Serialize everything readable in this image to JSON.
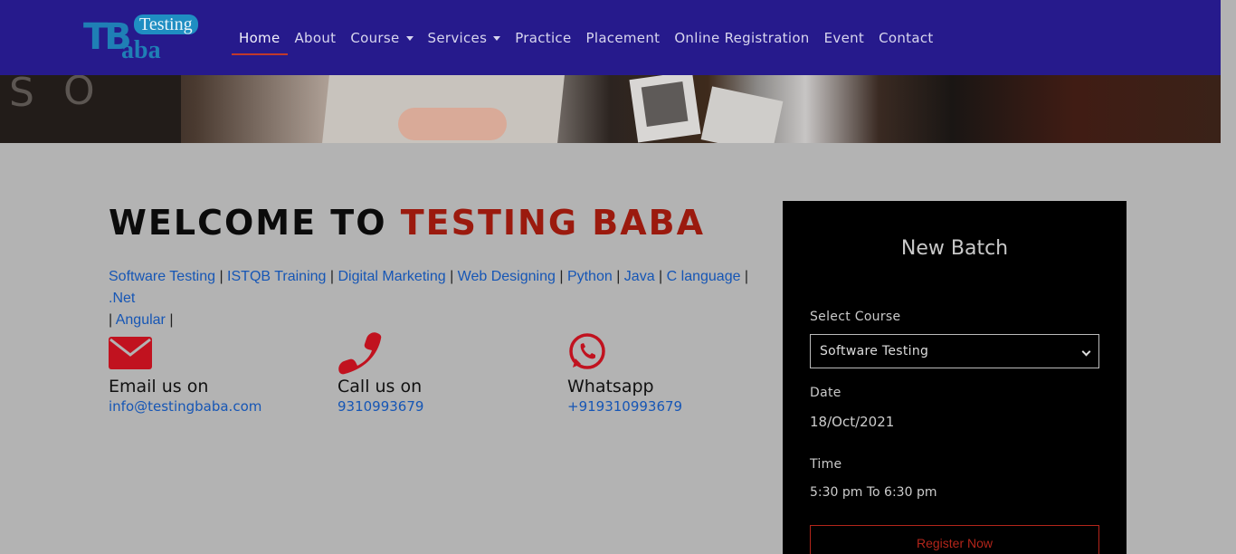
{
  "logo": {
    "tb": "TB",
    "testing": "Testing",
    "aba": "aba"
  },
  "nav": {
    "items": [
      {
        "label": "Home",
        "active": true,
        "dropdown": false
      },
      {
        "label": "About",
        "dropdown": false
      },
      {
        "label": "Course",
        "dropdown": true
      },
      {
        "label": "Services",
        "dropdown": true
      },
      {
        "label": "Practice",
        "dropdown": false
      },
      {
        "label": "Placement",
        "dropdown": false
      },
      {
        "label": "Online Registration",
        "dropdown": false
      },
      {
        "label": "Event",
        "dropdown": false
      },
      {
        "label": "Contact",
        "dropdown": false
      }
    ]
  },
  "welcome": {
    "prefix": "WELCOME TO ",
    "brand": "TESTING BABA"
  },
  "courses": [
    "Software Testing",
    "ISTQB Training",
    "Digital Marketing",
    "Web Designing",
    "Python",
    "Java",
    "C language",
    ".Net",
    "Angular"
  ],
  "contacts": [
    {
      "icon": "envelope-icon",
      "title": "Email us on",
      "value": "info@testingbaba.com"
    },
    {
      "icon": "phone-icon",
      "title": "Call us on",
      "value": "9310993679"
    },
    {
      "icon": "whatsapp-icon",
      "title": "Whatsapp",
      "value": "+919310993679"
    }
  ],
  "batch": {
    "title": "New Batch",
    "select_label": "Select Course",
    "selected_course": "Software Testing",
    "date_label": "Date",
    "date": "18/Oct/2021",
    "time_label": "Time",
    "time": "5:30 pm To 6:30 pm",
    "register": "Register Now"
  },
  "colors": {
    "navbar": "#261a8c",
    "brand_red": "#9b1a0e",
    "link_blue": "#1656b5",
    "icon_red": "#c1121f"
  }
}
